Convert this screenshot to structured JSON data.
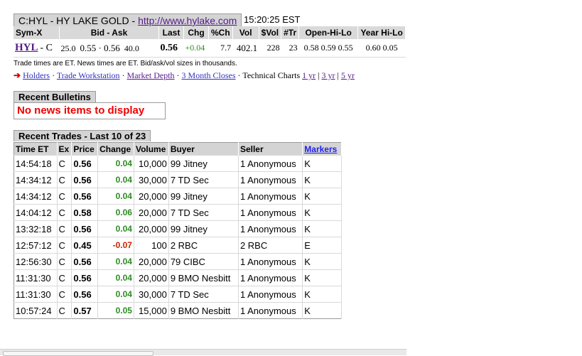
{
  "header": {
    "title_prefix": "C:HYL - HY LAKE GOLD - ",
    "url_text": "http://www.hylake.com",
    "time": "15:20:25 EST"
  },
  "quote": {
    "headers": [
      "Sym-X",
      "Bid - Ask",
      "Last",
      "Chg",
      "%Ch",
      "Vol",
      "$Vol",
      "#Tr",
      "Open-Hi-Lo",
      "Year Hi-Lo"
    ],
    "symbol": "HYL",
    "exchange": "- C",
    "bid_size": "25.0",
    "bid_ask": "0.55 · 0.56",
    "ask_size": "40.0",
    "last": "0.56",
    "chg": "+0.04",
    "pct_ch": "7.7",
    "vol": "402.1",
    "dollar_vol": "228",
    "trades": "23",
    "open": "0.58",
    "hi": "0.59",
    "lo": "0.55",
    "year_hi": "0.60",
    "year_lo": "0.05"
  },
  "note": "Trade times are ET. News times are ET. Bid/ask/vol sizes in thousands.",
  "nav": {
    "arrow": "➔",
    "holders": "Holders",
    "trade_workstation": "Trade Workstation",
    "market_depth": "Market Depth",
    "three_month": "3 Month Closes",
    "technical_charts": "Technical Charts",
    "yr1": "1 yr",
    "yr3": "3 yr",
    "yr5": "5 yr"
  },
  "bulletins": {
    "title": "Recent Bulletins",
    "empty": "No news items to display"
  },
  "trades": {
    "title": "Recent Trades - Last 10 of 23",
    "headers": [
      "Time ET",
      "Ex",
      "Price",
      "Change",
      "Volume",
      "Buyer",
      "Seller",
      "Markers"
    ],
    "rows": [
      {
        "time": "14:54:18",
        "ex": "C",
        "price": "0.56",
        "change": "0.04",
        "volume": "10,000",
        "buyer": "99 Jitney",
        "seller": "1 Anonymous",
        "marker": "K"
      },
      {
        "time": "14:34:12",
        "ex": "C",
        "price": "0.56",
        "change": "0.04",
        "volume": "30,000",
        "buyer": "7 TD Sec",
        "seller": "1 Anonymous",
        "marker": "K"
      },
      {
        "time": "14:34:12",
        "ex": "C",
        "price": "0.56",
        "change": "0.04",
        "volume": "20,000",
        "buyer": "99 Jitney",
        "seller": "1 Anonymous",
        "marker": "K"
      },
      {
        "time": "14:04:12",
        "ex": "C",
        "price": "0.58",
        "change": "0.06",
        "volume": "20,000",
        "buyer": "7 TD Sec",
        "seller": "1 Anonymous",
        "marker": "K"
      },
      {
        "time": "13:32:18",
        "ex": "C",
        "price": "0.56",
        "change": "0.04",
        "volume": "20,000",
        "buyer": "99 Jitney",
        "seller": "1 Anonymous",
        "marker": "K"
      },
      {
        "time": "12:57:12",
        "ex": "C",
        "price": "0.45",
        "change": "-0.07",
        "volume": "100",
        "buyer": "2 RBC",
        "seller": "2 RBC",
        "marker": "E"
      },
      {
        "time": "12:56:30",
        "ex": "C",
        "price": "0.56",
        "change": "0.04",
        "volume": "20,000",
        "buyer": "79 CIBC",
        "seller": "1 Anonymous",
        "marker": "K"
      },
      {
        "time": "11:31:30",
        "ex": "C",
        "price": "0.56",
        "change": "0.04",
        "volume": "20,000",
        "buyer": "9 BMO Nesbitt",
        "seller": "1 Anonymous",
        "marker": "K"
      },
      {
        "time": "11:31:30",
        "ex": "C",
        "price": "0.56",
        "change": "0.04",
        "volume": "30,000",
        "buyer": "7 TD Sec",
        "seller": "1 Anonymous",
        "marker": "K"
      },
      {
        "time": "10:57:24",
        "ex": "C",
        "price": "0.57",
        "change": "0.05",
        "volume": "15,000",
        "buyer": "9 BMO Nesbitt",
        "seller": "1 Anonymous",
        "marker": "K"
      }
    ]
  },
  "colors": {
    "up": "#2e8b22",
    "down": "#cc2200",
    "news_empty": "#ee0000",
    "header_bg": "#d4d4d4"
  }
}
